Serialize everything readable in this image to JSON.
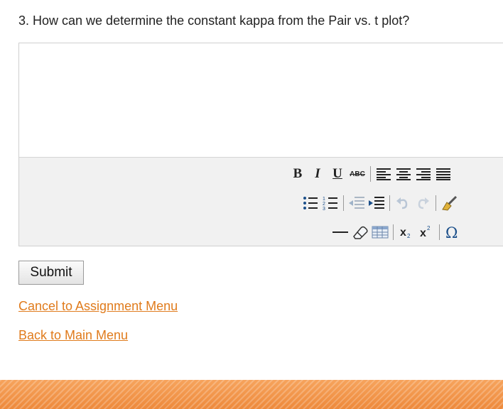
{
  "question": {
    "text": "3. How can we determine the constant kappa from the Pair vs. t plot?"
  },
  "editor": {
    "content": "",
    "toolbar": {
      "row1": [
        "bold-icon",
        "italic-icon",
        "underline-icon",
        "strikethrough-icon",
        "align-left-icon",
        "align-center-icon",
        "align-right-icon",
        "align-justify-icon"
      ],
      "row2": [
        "bulleted-list-icon",
        "numbered-list-icon",
        "outdent-icon",
        "indent-icon",
        "undo-icon",
        "redo-icon",
        "cleanup-icon"
      ],
      "row3": [
        "horizontal-rule-icon",
        "eraser-icon",
        "table-icon",
        "subscript-icon",
        "superscript-icon",
        "special-character-icon"
      ]
    }
  },
  "actions": {
    "submit_label": "Submit"
  },
  "links": {
    "cancel": "Cancel to Assignment Menu",
    "back": "Back to Main Menu"
  },
  "colors": {
    "link": "#e07b1c",
    "footer_band": "#f0903f",
    "toolbar_bg": "#f1f1f1"
  }
}
